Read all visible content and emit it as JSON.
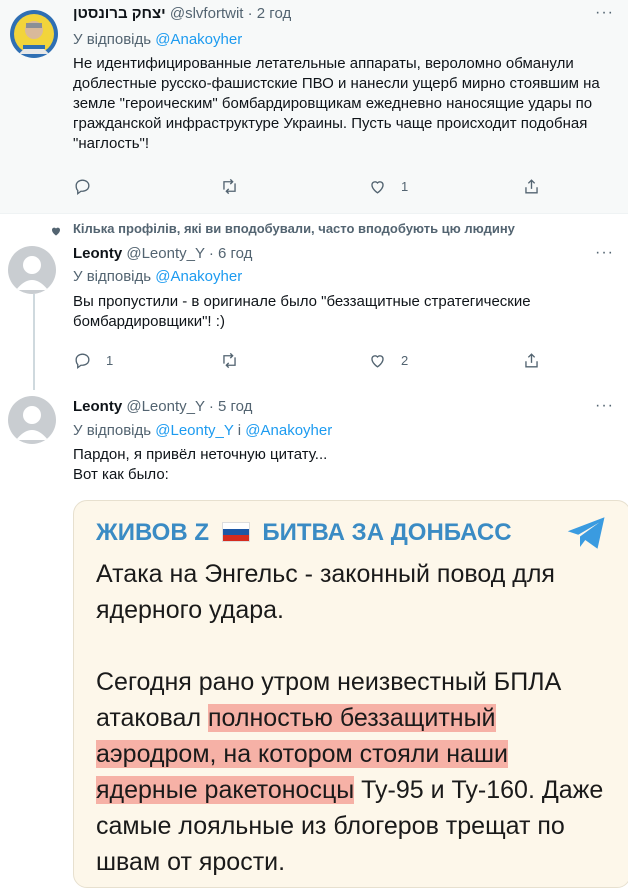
{
  "tweet1": {
    "name": "יצחק ברונסטן",
    "handle": "@slvfortwit",
    "time": "· 2 год",
    "reply_prefix": "У відповідь",
    "reply_to": "@Anakoyher",
    "text": "Не идентифицированные летательные аппараты, вероломно обманули доблестные русско-фашистские ПВО и нанесли ущерб мирно стоявшим на земле \"героическим\" бомбардировщикам ежедневно наносящие удары по гражданской инфраструктуре Украины. Пусть чаще происходит подобная \"наглость\"!",
    "reply_count": "",
    "retweet_count": "",
    "like_count": "1"
  },
  "social_context": "Кілька профілів, які ви вподобували, часто вподобують цю людину",
  "tweet2": {
    "name": "Leonty",
    "handle": "@Leonty_Y",
    "time": "· 6 год",
    "reply_prefix": "У відповідь",
    "reply_to": "@Anakoyher",
    "text": "Вы пропустили - в оригинале было \"беззащитные стратегические бомбардировщики\"! :)",
    "reply_count": "1",
    "retweet_count": "",
    "like_count": "2"
  },
  "tweet3": {
    "name": "Leonty",
    "handle": "@Leonty_Y",
    "time": "· 5 год",
    "reply_prefix": "У відповідь",
    "reply_to_1": "@Leonty_Y",
    "reply_join": "і",
    "reply_to_2": "@Anakoyher",
    "text_line1": "Пардон, я привёл неточную цитату...",
    "text_line2": "Вот как было:",
    "media": {
      "title_part1": "ЖИВОВ Z",
      "title_part2": "БИТВА ЗА ДОНБАСС",
      "para1": "Атака на Энгельс - законный повод для ядерного удара.",
      "para2_a": "Сегодня рано утром неизвестный БПЛА атаковал ",
      "para2_hl1": "полностью беззащитный",
      "para2_b": " ",
      "para2_hl2": "аэродром, на котором стояли наши ядерные ракетоносцы",
      "para2_c": " Ту-95 и Ту-160. Даже самые лояльные из блогеров трещат по швам от ярости."
    }
  },
  "icons": {
    "reply": "reply-icon",
    "retweet": "retweet-icon",
    "like": "like-icon",
    "share": "share-icon",
    "more": "more-icon",
    "telegram": "telegram-icon"
  },
  "colors": {
    "link": "#1d9bf0",
    "secondary_text": "#536471",
    "highlight": "#f0786e",
    "media_title": "#3a8bc4"
  }
}
